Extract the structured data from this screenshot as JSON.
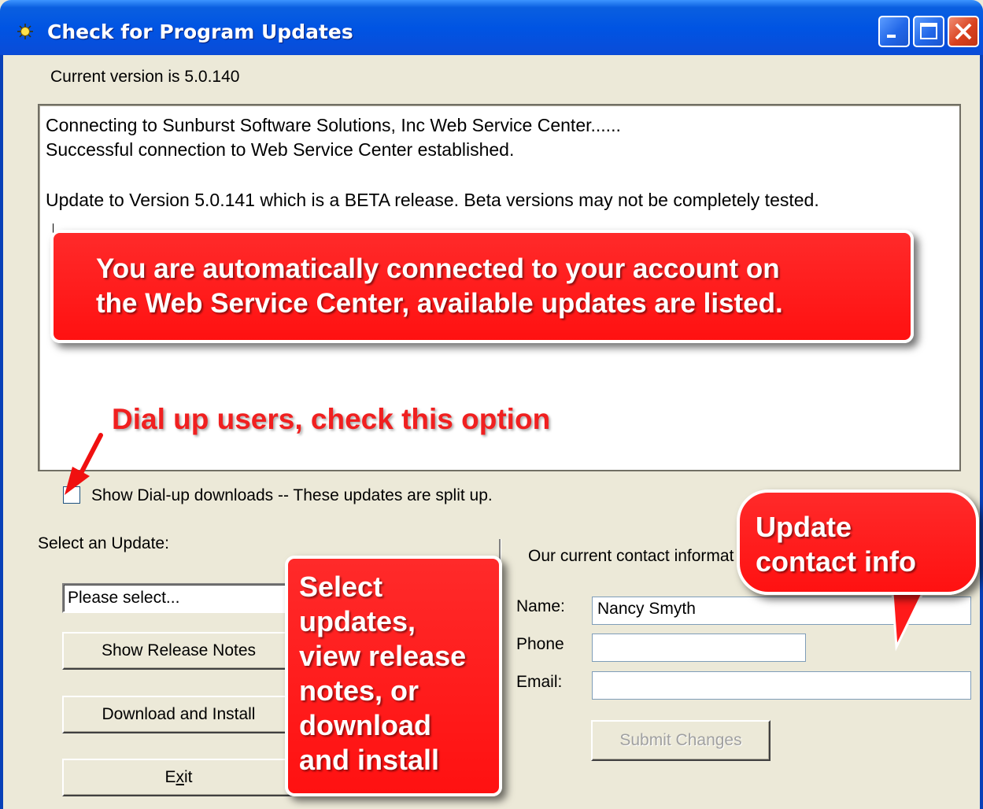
{
  "window": {
    "title": "Check for Program Updates",
    "icon": "sun-icon",
    "controls": [
      "minimize-icon",
      "maximize-icon",
      "close-icon"
    ]
  },
  "current_version_text": "Current version is 5.0.140",
  "log": {
    "lines": [
      "Connecting to Sunburst Software Solutions, Inc Web Service Center......",
      "Successful connection to Web Service Center established.",
      "",
      "Update to Version 5.0.141 which is a BETA release.  Beta versions may not be completely tested."
    ]
  },
  "dialup_checkbox": {
    "label": "Show Dial-up downloads -- These updates are split up.",
    "checked": false
  },
  "update_section": {
    "label": "Select an Update:",
    "select_value": "Please select...",
    "show_release_notes": "Show Release Notes",
    "download_install": "Download and Install",
    "exit_prefix": "E",
    "exit_underlined": "x",
    "exit_suffix": "it"
  },
  "contact": {
    "heading": "Our current contact informat",
    "name_label": "Name:",
    "name_value": "Nancy Smyth",
    "phone_label": "Phone",
    "phone_value": "",
    "email_label": "Email:",
    "email_value": "",
    "submit_label": "Submit Changes",
    "submit_enabled": false
  },
  "annotations": {
    "main_line1": "You are automatically connected to your account on",
    "main_line2": "the Web Service Center, available updates are listed.",
    "dialup": "Dial up users, check this option",
    "select_lines": [
      "Select",
      "updates,",
      "view release",
      "notes, or",
      "download",
      "and install"
    ],
    "contact_lines": [
      "Update",
      "contact info"
    ],
    "callout_color": "#FF1A1A",
    "titlebar_color": "#0054E3"
  }
}
